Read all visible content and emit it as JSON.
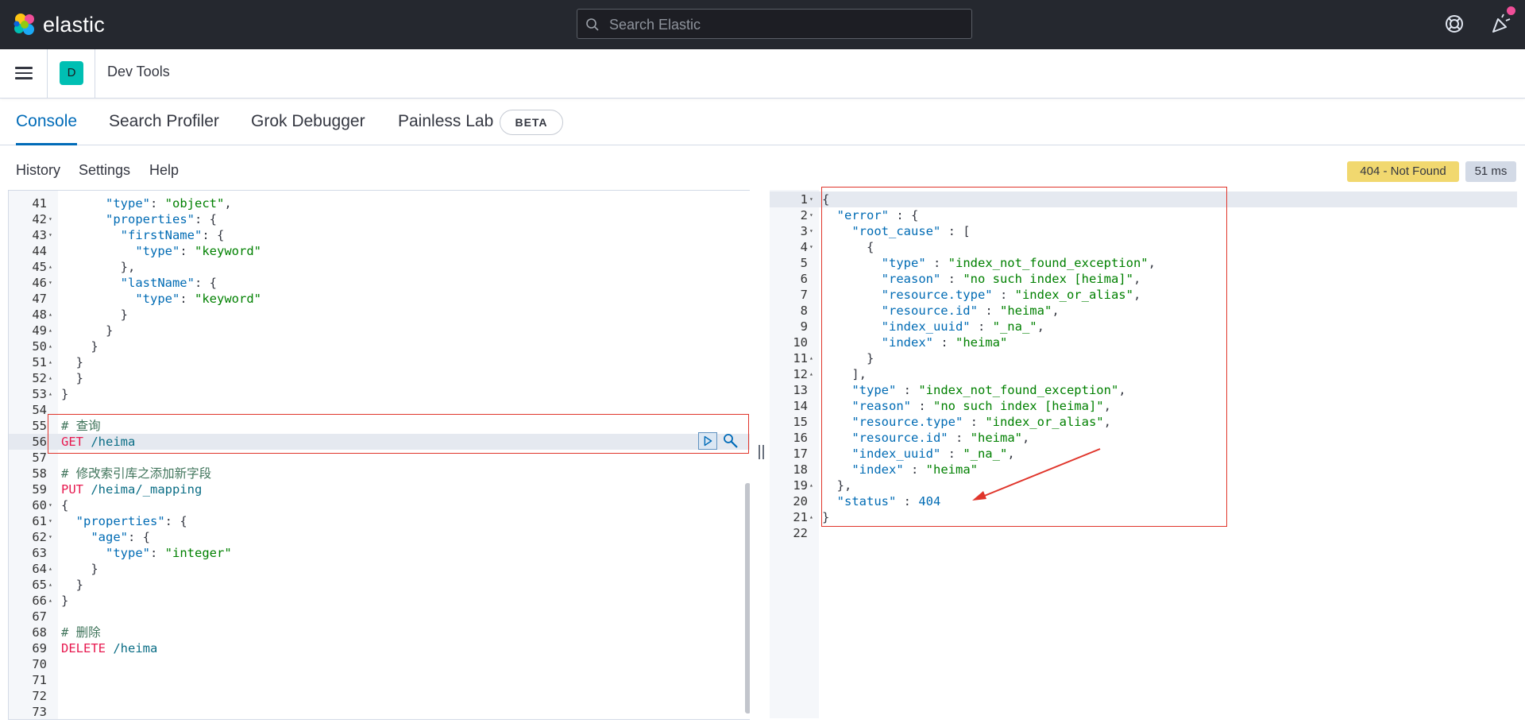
{
  "header": {
    "brand": "elastic",
    "search_placeholder": "Search Elastic"
  },
  "appbar": {
    "space_initial": "D",
    "title": "Dev Tools"
  },
  "tabs": [
    {
      "label": "Console",
      "active": true
    },
    {
      "label": "Search Profiler",
      "active": false
    },
    {
      "label": "Grok Debugger",
      "active": false
    },
    {
      "label": "Painless Lab",
      "active": false
    }
  ],
  "beta_badge": "BETA",
  "toolbar": {
    "history": "History",
    "settings": "Settings",
    "help": "Help",
    "status": "404 - Not Found",
    "time": "51 ms"
  },
  "request_lines": [
    {
      "n": "41",
      "fold": "",
      "code": "      \"type\": \"object\","
    },
    {
      "n": "42",
      "fold": "▾",
      "code": "      \"properties\": {"
    },
    {
      "n": "43",
      "fold": "▾",
      "code": "        \"firstName\": {"
    },
    {
      "n": "44",
      "fold": "",
      "code": "          \"type\": \"keyword\""
    },
    {
      "n": "45",
      "fold": "▴",
      "code": "        },"
    },
    {
      "n": "46",
      "fold": "▾",
      "code": "        \"lastName\": {"
    },
    {
      "n": "47",
      "fold": "",
      "code": "          \"type\": \"keyword\""
    },
    {
      "n": "48",
      "fold": "▴",
      "code": "        }"
    },
    {
      "n": "49",
      "fold": "▴",
      "code": "      }"
    },
    {
      "n": "50",
      "fold": "▴",
      "code": "    }"
    },
    {
      "n": "51",
      "fold": "▴",
      "code": "  }"
    },
    {
      "n": "52",
      "fold": "▴",
      "code": "  }"
    },
    {
      "n": "53",
      "fold": "▴",
      "code": "}"
    },
    {
      "n": "54",
      "fold": "",
      "code": ""
    },
    {
      "n": "55",
      "fold": "",
      "code": "# 查询"
    },
    {
      "n": "56",
      "fold": "",
      "code": "GET /heima"
    },
    {
      "n": "57",
      "fold": "",
      "code": ""
    },
    {
      "n": "58",
      "fold": "",
      "code": "# 修改索引库之添加新字段"
    },
    {
      "n": "59",
      "fold": "",
      "code": "PUT /heima/_mapping"
    },
    {
      "n": "60",
      "fold": "▾",
      "code": "{"
    },
    {
      "n": "61",
      "fold": "▾",
      "code": "  \"properties\": {"
    },
    {
      "n": "62",
      "fold": "▾",
      "code": "    \"age\": {"
    },
    {
      "n": "63",
      "fold": "",
      "code": "      \"type\": \"integer\""
    },
    {
      "n": "64",
      "fold": "▴",
      "code": "    }"
    },
    {
      "n": "65",
      "fold": "▴",
      "code": "  }"
    },
    {
      "n": "66",
      "fold": "▴",
      "code": "}"
    },
    {
      "n": "67",
      "fold": "",
      "code": ""
    },
    {
      "n": "68",
      "fold": "",
      "code": "# 删除"
    },
    {
      "n": "69",
      "fold": "",
      "code": "DELETE /heima"
    },
    {
      "n": "70",
      "fold": "",
      "code": ""
    },
    {
      "n": "71",
      "fold": "",
      "code": ""
    },
    {
      "n": "72",
      "fold": "",
      "code": ""
    },
    {
      "n": "73",
      "fold": "",
      "code": ""
    }
  ],
  "response_lines": [
    {
      "n": "1",
      "fold": "▾",
      "code": "{"
    },
    {
      "n": "2",
      "fold": "▾",
      "code": "  \"error\" : {"
    },
    {
      "n": "3",
      "fold": "▾",
      "code": "    \"root_cause\" : ["
    },
    {
      "n": "4",
      "fold": "▾",
      "code": "      {"
    },
    {
      "n": "5",
      "fold": "",
      "code": "        \"type\" : \"index_not_found_exception\","
    },
    {
      "n": "6",
      "fold": "",
      "code": "        \"reason\" : \"no such index [heima]\","
    },
    {
      "n": "7",
      "fold": "",
      "code": "        \"resource.type\" : \"index_or_alias\","
    },
    {
      "n": "8",
      "fold": "",
      "code": "        \"resource.id\" : \"heima\","
    },
    {
      "n": "9",
      "fold": "",
      "code": "        \"index_uuid\" : \"_na_\","
    },
    {
      "n": "10",
      "fold": "",
      "code": "        \"index\" : \"heima\""
    },
    {
      "n": "11",
      "fold": "▴",
      "code": "      }"
    },
    {
      "n": "12",
      "fold": "▴",
      "code": "    ],"
    },
    {
      "n": "13",
      "fold": "",
      "code": "    \"type\" : \"index_not_found_exception\","
    },
    {
      "n": "14",
      "fold": "",
      "code": "    \"reason\" : \"no such index [heima]\","
    },
    {
      "n": "15",
      "fold": "",
      "code": "    \"resource.type\" : \"index_or_alias\","
    },
    {
      "n": "16",
      "fold": "",
      "code": "    \"resource.id\" : \"heima\","
    },
    {
      "n": "17",
      "fold": "",
      "code": "    \"index_uuid\" : \"_na_\","
    },
    {
      "n": "18",
      "fold": "",
      "code": "    \"index\" : \"heima\""
    },
    {
      "n": "19",
      "fold": "▴",
      "code": "  },"
    },
    {
      "n": "20",
      "fold": "",
      "code": "  \"status\" : 404"
    },
    {
      "n": "21",
      "fold": "▴",
      "code": "}"
    },
    {
      "n": "22",
      "fold": "",
      "code": ""
    }
  ],
  "colors": {
    "header_bg": "#25282f",
    "accent": "#006bb8",
    "status_warning": "#f1d86f",
    "annotation_red": "#e0352b"
  }
}
